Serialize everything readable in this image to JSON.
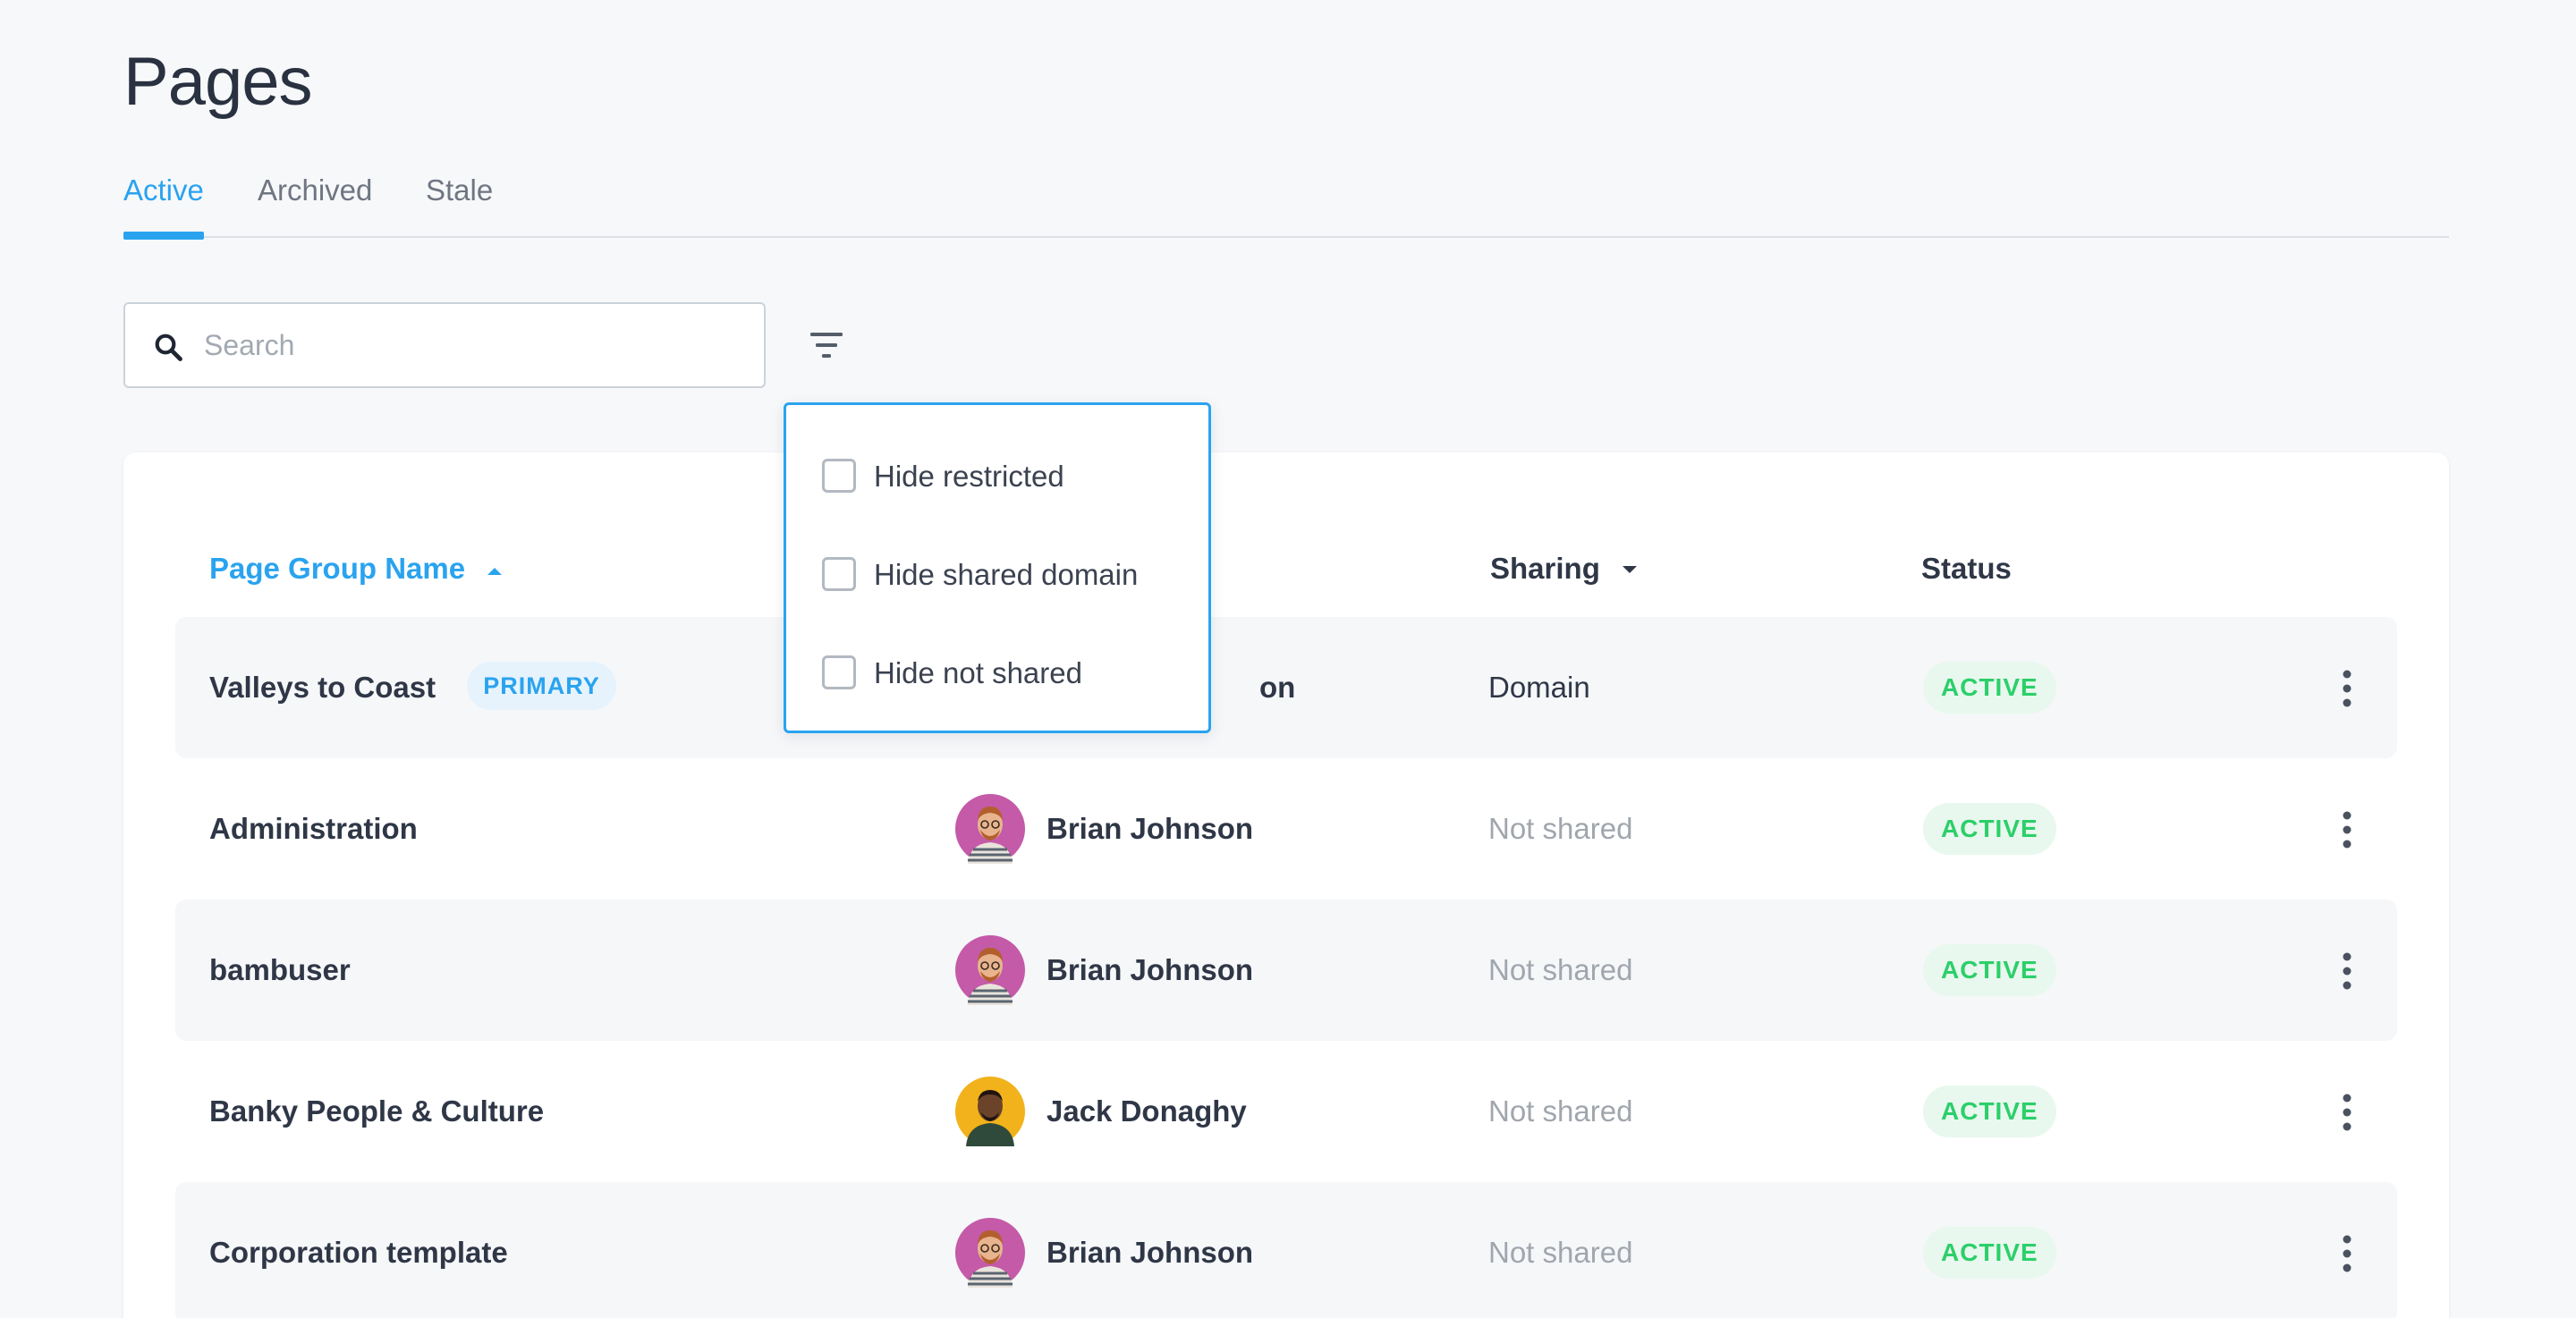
{
  "page": {
    "title": "Pages"
  },
  "tabs": [
    {
      "label": "Active",
      "active": true
    },
    {
      "label": "Archived",
      "active": false
    },
    {
      "label": "Stale",
      "active": false
    }
  ],
  "search": {
    "placeholder": "Search",
    "value": "",
    "icon": "search-icon"
  },
  "filter": {
    "icon": "filter-icon",
    "options": [
      {
        "label": "Hide restricted",
        "checked": false
      },
      {
        "label": "Hide shared domain",
        "checked": false
      },
      {
        "label": "Hide not shared",
        "checked": false
      }
    ]
  },
  "table": {
    "columns": {
      "name": "Page Group Name",
      "sharing": "Sharing",
      "status": "Status"
    },
    "rows": [
      {
        "name": "Valleys to Coast",
        "badge": "PRIMARY",
        "owner": "on",
        "sharing": "Domain",
        "status": "ACTIVE"
      },
      {
        "name": "Administration",
        "owner": "Brian Johnson",
        "sharing": "Not shared",
        "status": "ACTIVE"
      },
      {
        "name": "bambuser",
        "owner": "Brian Johnson",
        "sharing": "Not shared",
        "status": "ACTIVE"
      },
      {
        "name": "Banky People & Culture",
        "owner": "Jack Donaghy",
        "sharing": "Not shared",
        "status": "ACTIVE"
      },
      {
        "name": "Corporation template",
        "owner": "Brian Johnson",
        "sharing": "Not shared",
        "status": "ACTIVE"
      }
    ]
  },
  "colors": {
    "accent": "#2aa3ef",
    "status_active_bg": "#e8f8ee",
    "status_active_text": "#2ccf6a",
    "avatar_brian_bg": "#c45aa8",
    "avatar_jack_bg": "#f2b21b"
  }
}
